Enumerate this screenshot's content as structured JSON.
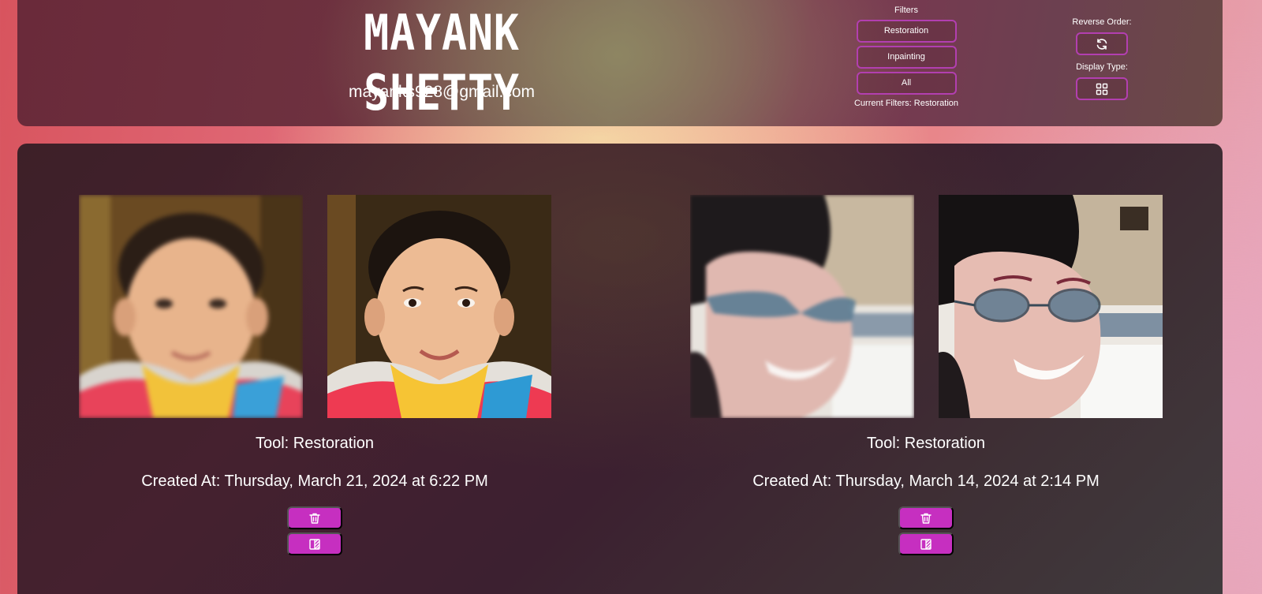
{
  "profile": {
    "name": "MAYANK SHETTY",
    "email": "mayanks928@gmail.com"
  },
  "filters": {
    "title": "Filters",
    "options": [
      "Restoration",
      "Inpainting",
      "All"
    ],
    "current_label": "Current Filters: Restoration"
  },
  "controls": {
    "reverse_order_label": "Reverse Order:",
    "reverse_order_icon": "refresh-icon",
    "display_type_label": "Display Type:",
    "display_type_icon": "grid-icon"
  },
  "results": [
    {
      "tool": "Tool: Restoration",
      "created": "Created At: Thursday, March 21, 2024 at 6:22 PM",
      "images": [
        "child-portrait-blurry",
        "child-portrait-restored"
      ],
      "actions": [
        "trash-icon",
        "compare-icon"
      ]
    },
    {
      "tool": "Tool: Restoration",
      "created": "Created At: Thursday, March 14, 2024 at 2:14 PM",
      "images": [
        "man-portrait-blurry",
        "man-portrait-restored"
      ],
      "actions": [
        "trash-icon",
        "compare-icon"
      ]
    }
  ],
  "colors": {
    "accent_button": "#c62fc0",
    "outline_button": "#b23fb0"
  }
}
